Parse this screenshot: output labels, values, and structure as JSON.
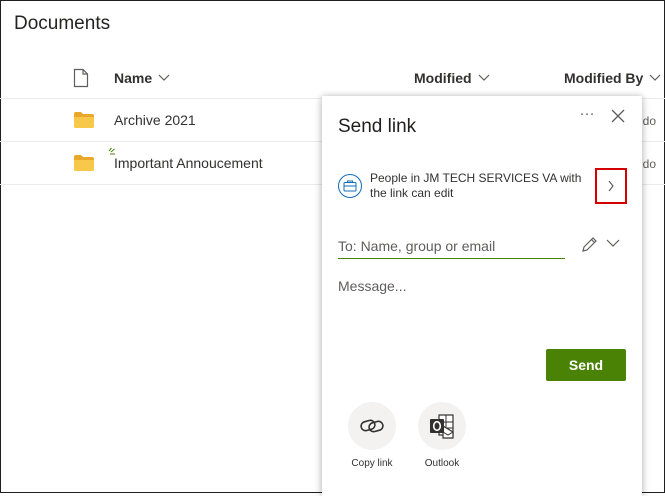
{
  "page": {
    "title": "Documents"
  },
  "columns": {
    "name": "Name",
    "modified": "Modified",
    "modified_by": "Modified By"
  },
  "rows": [
    {
      "name": "Archive 2021",
      "modified_by_partial": "ido"
    },
    {
      "name": "Important Annoucement",
      "modified_by_partial": "ido"
    }
  ],
  "panel": {
    "title": "Send link",
    "permission_text": "People in JM TECH SERVICES VA with the link can edit",
    "to_placeholder": "To: Name, group or email",
    "message_placeholder": "Message...",
    "send_label": "Send",
    "options": [
      {
        "label": "Copy link",
        "icon": "link-icon"
      },
      {
        "label": "Outlook",
        "icon": "outlook-icon"
      }
    ]
  },
  "colors": {
    "accent_green": "#498205",
    "highlight_red": "#d40000",
    "folder_yellow": "#f8c84a",
    "permission_blue": "#0f6cbd"
  }
}
